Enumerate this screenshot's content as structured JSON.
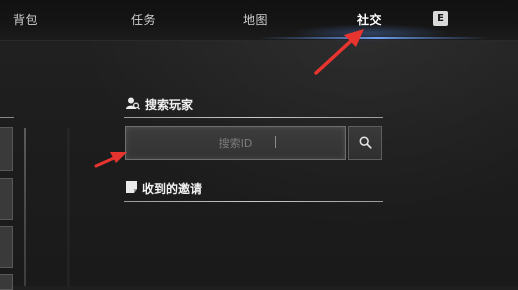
{
  "nav": {
    "tabs": [
      {
        "label": "背包"
      },
      {
        "label": "任务"
      },
      {
        "label": "地图"
      },
      {
        "label": "社交",
        "active": true
      }
    ],
    "key_hint": "E"
  },
  "social": {
    "search": {
      "title": "搜索玩家",
      "placeholder": "搜索ID",
      "value": ""
    },
    "invites": {
      "title": "收到的邀请"
    }
  },
  "colors": {
    "annotation_arrow": "#e8342f",
    "tab_highlight": "#78aaff"
  },
  "icons": [
    "user-search-icon",
    "search-icon",
    "invitation-icon"
  ]
}
